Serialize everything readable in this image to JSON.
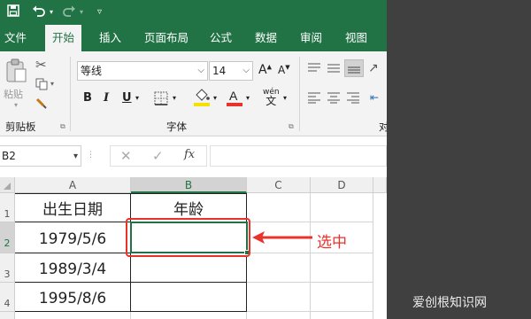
{
  "title_bar": {
    "save_icon": "save-icon",
    "undo_icon": "undo-icon",
    "redo_icon": "redo-icon",
    "customize_icon": "customize-qat-icon"
  },
  "tabs": [
    "文件",
    "开始",
    "插入",
    "页面布局",
    "公式",
    "数据",
    "审阅",
    "视图"
  ],
  "ribbon": {
    "paste_label": "粘贴",
    "clipboard_group": "剪贴板",
    "font_group": "字体",
    "font_name": "等线",
    "font_size": "14",
    "bold": "B",
    "italic": "I",
    "underline": "U",
    "wen_label": "wén",
    "wen_char": "文",
    "align_group_partial": "对",
    "font_color": "#e8322a",
    "highlight_color": "#f5e000"
  },
  "formula_bar": {
    "name_box": "B2",
    "fx": "fx",
    "content": ""
  },
  "grid": {
    "columns": [
      "A",
      "B",
      "C",
      "D"
    ],
    "rows": [
      "1",
      "2",
      "3",
      "4"
    ],
    "cells": {
      "A1": "出生日期",
      "B1": "年龄",
      "A2": "1979/5/6",
      "B2": "",
      "A3": "1989/3/4",
      "B3": "",
      "A4": "1995/8/6",
      "B4": ""
    },
    "selected_header": "B"
  },
  "annotation": {
    "label": "选中",
    "color": "#e8322a"
  },
  "watermark": "爱创根知识网"
}
